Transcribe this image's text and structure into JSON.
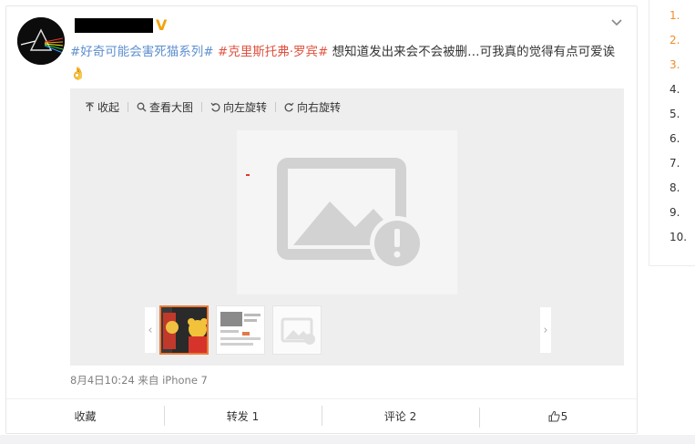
{
  "post": {
    "tag1": "#好奇可能会害死猫系列#",
    "tag2": "#克里斯托弗·罗宾#",
    "text": " 想知道发出来会不会被删…可我真的觉得有点可爱诶",
    "emoji": "👌",
    "verified_badge": "V",
    "timestamp": "8月4日10:24 来自 iPhone 7"
  },
  "media_toolbar": {
    "collapse_label": "收起",
    "view_large_label": "查看大图",
    "rotate_left_label": "向左旋转",
    "rotate_right_label": "向右旋转"
  },
  "actions": {
    "favorite_label": "收藏",
    "repost_label": "转发 1",
    "comment_label": "评论 2",
    "like_count": "5"
  },
  "side_list": {
    "items": [
      "1.",
      "2.",
      "3.",
      "4.",
      "5.",
      "6.",
      "7.",
      "8.",
      "9.",
      "10."
    ]
  },
  "colors": {
    "accent_orange": "#ea7d3c",
    "tag_blue": "#5d8fce",
    "tag_red": "#e0523f",
    "verified_gold": "#f2a30a"
  },
  "icons": {
    "collapse": "upload-icon",
    "view_large": "search-icon",
    "rotate_left": "rotate-left-icon",
    "rotate_right": "rotate-right-icon",
    "more": "chevron-down-icon",
    "like": "thumbs-up-icon",
    "image_broken": "broken-image-icon"
  }
}
